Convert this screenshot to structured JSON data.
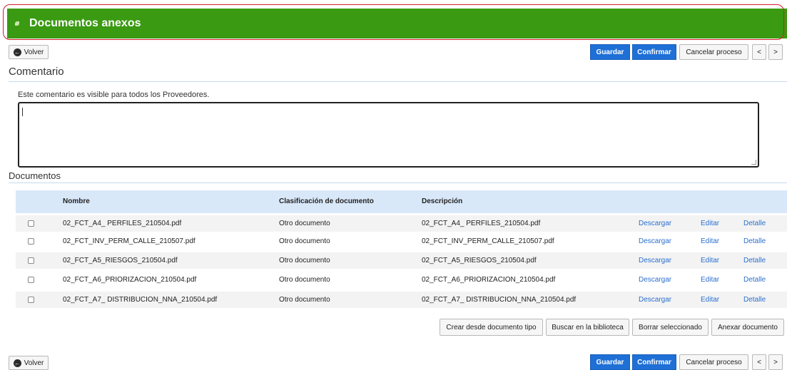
{
  "header": {
    "title": "Documentos anexos"
  },
  "toolbar": {
    "back": "Volver",
    "save": "Guardar",
    "confirm": "Confirmar",
    "cancel": "Cancelar proceso",
    "prev": "<",
    "next": ">"
  },
  "comment": {
    "section_title": "Comentario",
    "hint": "Este comentario es visible para todos los Proveedores.",
    "value": ""
  },
  "documents": {
    "section_title": "Documentos",
    "columns": [
      "Nombre",
      "Clasificación de documento",
      "Descripción"
    ],
    "rows": [
      {
        "name": "02_FCT_A4_ PERFILES_210504.pdf",
        "classification": "Otro documento",
        "description": "02_FCT_A4_ PERFILES_210504.pdf",
        "download": "Descargar",
        "edit": "Editar",
        "detail": "Detalle"
      },
      {
        "name": "02_FCT_INV_PERM_CALLE_210507.pdf",
        "classification": "Otro documento",
        "description": "02_FCT_INV_PERM_CALLE_210507.pdf",
        "download": "Descargar",
        "edit": "Editar",
        "detail": "Detalle"
      },
      {
        "name": "02_FCT_A5_RIESGOS_210504.pdf",
        "classification": "Otro documento",
        "description": "02_FCT_A5_RIESGOS_210504.pdf",
        "download": "Descargar",
        "edit": "Editar",
        "detail": "Detalle"
      },
      {
        "name": "02_FCT_A6_PRIORIZACION_210504.pdf",
        "classification": "Otro documento",
        "description": "02_FCT_A6_PRIORIZACION_210504.pdf",
        "download": "Descargar",
        "edit": "Editar",
        "detail": "Detalle"
      },
      {
        "name": "02_FCT_A7_ DISTRIBUCION_NNA_210504.pdf",
        "classification": "Otro documento",
        "description": "02_FCT_A7_ DISTRIBUCION_NNA_210504.pdf",
        "download": "Descargar",
        "edit": "Editar",
        "detail": "Detalle"
      }
    ],
    "actions": {
      "create_from_type": "Crear desde documento tipo",
      "search_library": "Buscar en la biblioteca",
      "delete_selected": "Borrar seleccionado",
      "attach": "Anexar documento"
    }
  },
  "colors": {
    "header_green": "#3a9a12",
    "primary_blue": "#1e6fd6",
    "link_blue": "#2a6fcf",
    "table_header": "#d9e8f9",
    "outline_red": "#d21f2a"
  },
  "icons": {
    "back": "arrow-left-circle-icon",
    "header": "leaf-icon"
  }
}
